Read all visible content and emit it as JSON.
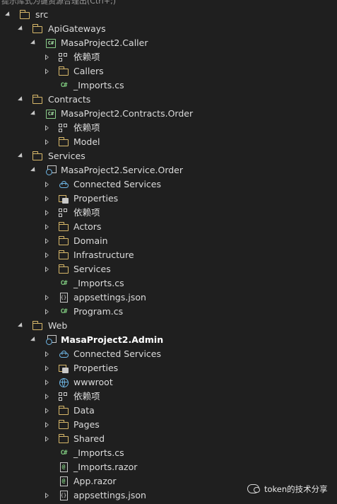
{
  "header": {
    "title_fragment": "提示库式为键资源合理出(Ctrl+;)"
  },
  "tree": [
    {
      "label": "src",
      "icon": "folder",
      "level": 0,
      "expander": "open"
    },
    {
      "label": "ApiGateways",
      "icon": "folder",
      "level": 1,
      "expander": "open"
    },
    {
      "label": "MasaProject2.Caller",
      "icon": "csproj",
      "level": 2,
      "expander": "open"
    },
    {
      "label": "依赖项",
      "icon": "deps",
      "level": 3,
      "expander": "closed"
    },
    {
      "label": "Callers",
      "icon": "folder",
      "level": 3,
      "expander": "closed"
    },
    {
      "label": "_Imports.cs",
      "icon": "cs",
      "level": 3,
      "expander": "none"
    },
    {
      "label": "Contracts",
      "icon": "folder",
      "level": 1,
      "expander": "open"
    },
    {
      "label": "MasaProject2.Contracts.Order",
      "icon": "csproj",
      "level": 2,
      "expander": "open"
    },
    {
      "label": "依赖项",
      "icon": "deps",
      "level": 3,
      "expander": "closed"
    },
    {
      "label": "Model",
      "icon": "folder",
      "level": 3,
      "expander": "closed"
    },
    {
      "label": "Services",
      "icon": "folder",
      "level": 1,
      "expander": "open"
    },
    {
      "label": "MasaProject2.Service.Order",
      "icon": "webproj",
      "level": 2,
      "expander": "open"
    },
    {
      "label": "Connected Services",
      "icon": "connected",
      "level": 3,
      "expander": "closed"
    },
    {
      "label": "Properties",
      "icon": "props",
      "level": 3,
      "expander": "closed"
    },
    {
      "label": "依赖项",
      "icon": "deps",
      "level": 3,
      "expander": "closed"
    },
    {
      "label": "Actors",
      "icon": "folder",
      "level": 3,
      "expander": "closed"
    },
    {
      "label": "Domain",
      "icon": "folder",
      "level": 3,
      "expander": "closed"
    },
    {
      "label": "Infrastructure",
      "icon": "folder",
      "level": 3,
      "expander": "closed"
    },
    {
      "label": "Services",
      "icon": "folder",
      "level": 3,
      "expander": "closed"
    },
    {
      "label": "_Imports.cs",
      "icon": "cs",
      "level": 3,
      "expander": "none"
    },
    {
      "label": "appsettings.json",
      "icon": "json",
      "level": 3,
      "expander": "closed"
    },
    {
      "label": "Program.cs",
      "icon": "cs",
      "level": 3,
      "expander": "closed"
    },
    {
      "label": "Web",
      "icon": "folder",
      "level": 1,
      "expander": "open"
    },
    {
      "label": "MasaProject2.Admin",
      "icon": "webproj",
      "level": 2,
      "expander": "open",
      "bold": true
    },
    {
      "label": "Connected Services",
      "icon": "connected",
      "level": 3,
      "expander": "closed"
    },
    {
      "label": "Properties",
      "icon": "props",
      "level": 3,
      "expander": "closed"
    },
    {
      "label": "wwwroot",
      "icon": "globe",
      "level": 3,
      "expander": "closed"
    },
    {
      "label": "依赖项",
      "icon": "deps",
      "level": 3,
      "expander": "closed"
    },
    {
      "label": "Data",
      "icon": "folder",
      "level": 3,
      "expander": "closed"
    },
    {
      "label": "Pages",
      "icon": "folder",
      "level": 3,
      "expander": "closed"
    },
    {
      "label": "Shared",
      "icon": "folder",
      "level": 3,
      "expander": "closed"
    },
    {
      "label": "_Imports.cs",
      "icon": "cs",
      "level": 3,
      "expander": "none"
    },
    {
      "label": "_Imports.razor",
      "icon": "razor",
      "level": 3,
      "expander": "none"
    },
    {
      "label": "App.razor",
      "icon": "razor",
      "level": 3,
      "expander": "none"
    },
    {
      "label": "appsettings.json",
      "icon": "json",
      "level": 3,
      "expander": "closed"
    }
  ],
  "watermark": {
    "text": "token的技术分享",
    "icon": "wechat-icon"
  }
}
